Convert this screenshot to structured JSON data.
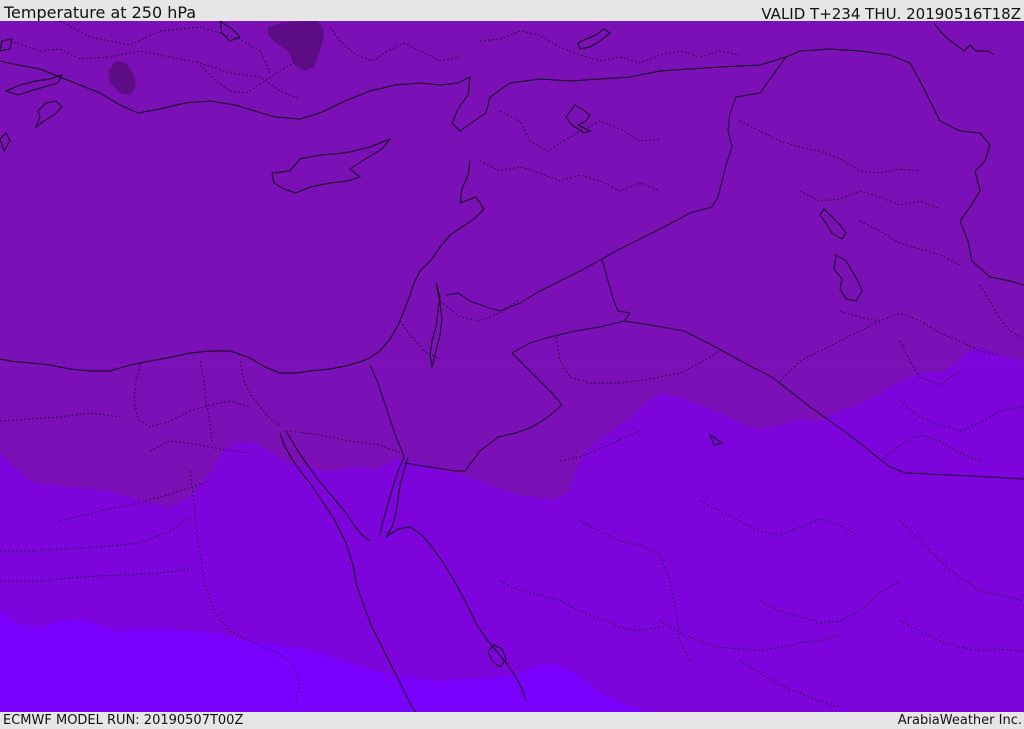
{
  "header": {
    "title": "Temperature at 250 hPa",
    "valid_time": "VALID T+234 THU. 20190516T18Z"
  },
  "footer": {
    "model_run": "ECMWF MODEL RUN: 20190507T00Z",
    "credit": "ArabiaWeather Inc."
  },
  "map": {
    "field": "temperature",
    "level": "250 hPa",
    "fill_colors": {
      "cold_spot": "#5c0d86",
      "band_north": "#7b10b6",
      "band_middle": "#7d05db",
      "band_south": "#7a00ff"
    },
    "line_colors": {
      "coastline": "#12001c",
      "border": "#1c0030"
    }
  }
}
